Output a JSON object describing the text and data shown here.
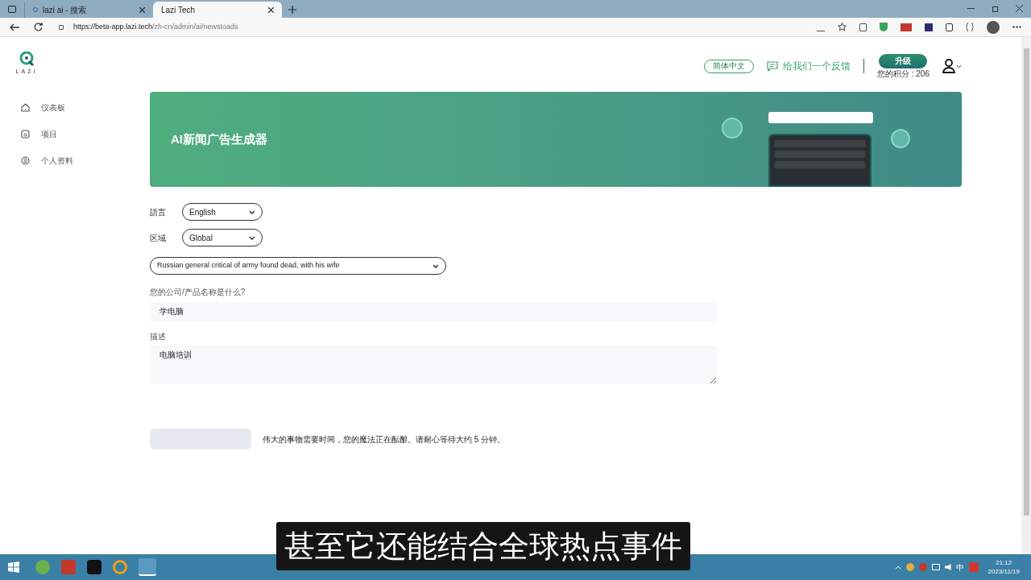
{
  "browser": {
    "tabs": [
      {
        "title": "lazi ai - 搜索",
        "selected": false
      },
      {
        "title": "Lazi Tech",
        "selected": true
      }
    ],
    "url_host": "https://beta-app.lazi.tech",
    "url_path": "/zh-cn/admin/ai/newstoads"
  },
  "header": {
    "language_button": "简体中文",
    "feedback": "给我们一个反馈",
    "upgrade_button": "升级",
    "points": "您的积分 : 206"
  },
  "logo_text": "LAZI",
  "sidebar": {
    "items": [
      {
        "label": "仪表板",
        "kind": "home"
      },
      {
        "label": "项目",
        "kind": "project"
      },
      {
        "label": "个人资料",
        "kind": "profile"
      }
    ]
  },
  "banner": {
    "title": "AI新闻广告生成器"
  },
  "form": {
    "language_label": "語言",
    "language_value": "English",
    "region_label": "区域",
    "region_value": "Global",
    "news_value": "Russian general critical of army found dead, with his wife",
    "company_label": "您的公司/产品名称是什么?",
    "company_value": "学电脑",
    "description_label": "描述",
    "description_value": "电脑培训",
    "wait_message": "伟大的事物需要时间，您的魔法正在酝酿。请耐心等待大约 5 分钟。"
  },
  "subtitle": "甚至它还能结合全球热点事件",
  "taskbar": {
    "lang": "中",
    "time": "21:12",
    "date": "2023/11/19"
  }
}
